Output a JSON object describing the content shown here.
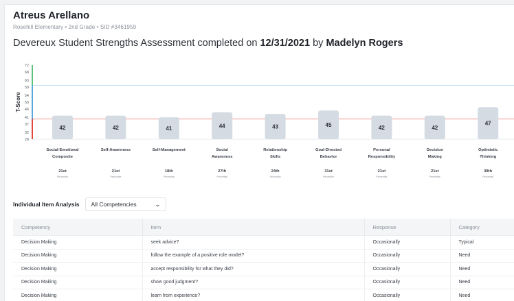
{
  "student": {
    "name": "Atreus Arellano",
    "meta": "Rosehill Elementary • 2nd Grade • SID #3461959"
  },
  "assessment": {
    "prefix": "Devereux Student Strengths Assessment completed on ",
    "date": "12/31/2021",
    "by_text": " by ",
    "rater": "Madelyn Rogers"
  },
  "colors": {
    "green": "#5cc37a",
    "blue": "#5aa6df",
    "red": "#e0463c",
    "bar": "#d4dbe2"
  },
  "chart_data": {
    "type": "bar",
    "ylabel": "T-Score",
    "yticks": [
      28,
      32,
      37,
      41,
      46,
      50,
      54,
      59,
      63,
      68,
      72
    ],
    "ylim": [
      28,
      72
    ],
    "thresholds": {
      "need_max": 40,
      "strength_min": 60
    },
    "categories": [
      [
        "Social-Emotional",
        "Composite"
      ],
      [
        "Self-Awareness"
      ],
      [
        "Self-Management"
      ],
      [
        "Social",
        "Awareness"
      ],
      [
        "Relationship",
        "Skills"
      ],
      [
        "Goal-Directed",
        "Behavior"
      ],
      [
        "Personal",
        "Responsibility"
      ],
      [
        "Decision",
        "Making"
      ],
      [
        "Optimistic",
        "Thinking"
      ]
    ],
    "values": [
      42,
      42,
      41,
      44,
      43,
      45,
      42,
      42,
      47
    ],
    "percentiles": [
      "21st",
      "21st",
      "18th",
      "27th",
      "24th",
      "31st",
      "21st",
      "21st",
      "38th"
    ],
    "percentile_label": "Percentile"
  },
  "filter": {
    "label": "Individual Item Analysis",
    "selected": "All Competencies"
  },
  "table": {
    "headers": [
      "Competency",
      "Item",
      "Response",
      "Category"
    ],
    "rows": [
      [
        "Decision Making",
        "seek advice?",
        "Occasionally",
        "Typical"
      ],
      [
        "Decision Making",
        "follow the example of a positive role model?",
        "Occasionally",
        "Need"
      ],
      [
        "Decision Making",
        "accept responsibility for what they did?",
        "Occasionally",
        "Need"
      ],
      [
        "Decision Making",
        "show good judgment?",
        "Occasionally",
        "Need"
      ],
      [
        "Decision Making",
        "learn from experience?",
        "Occasionally",
        "Need"
      ]
    ]
  }
}
